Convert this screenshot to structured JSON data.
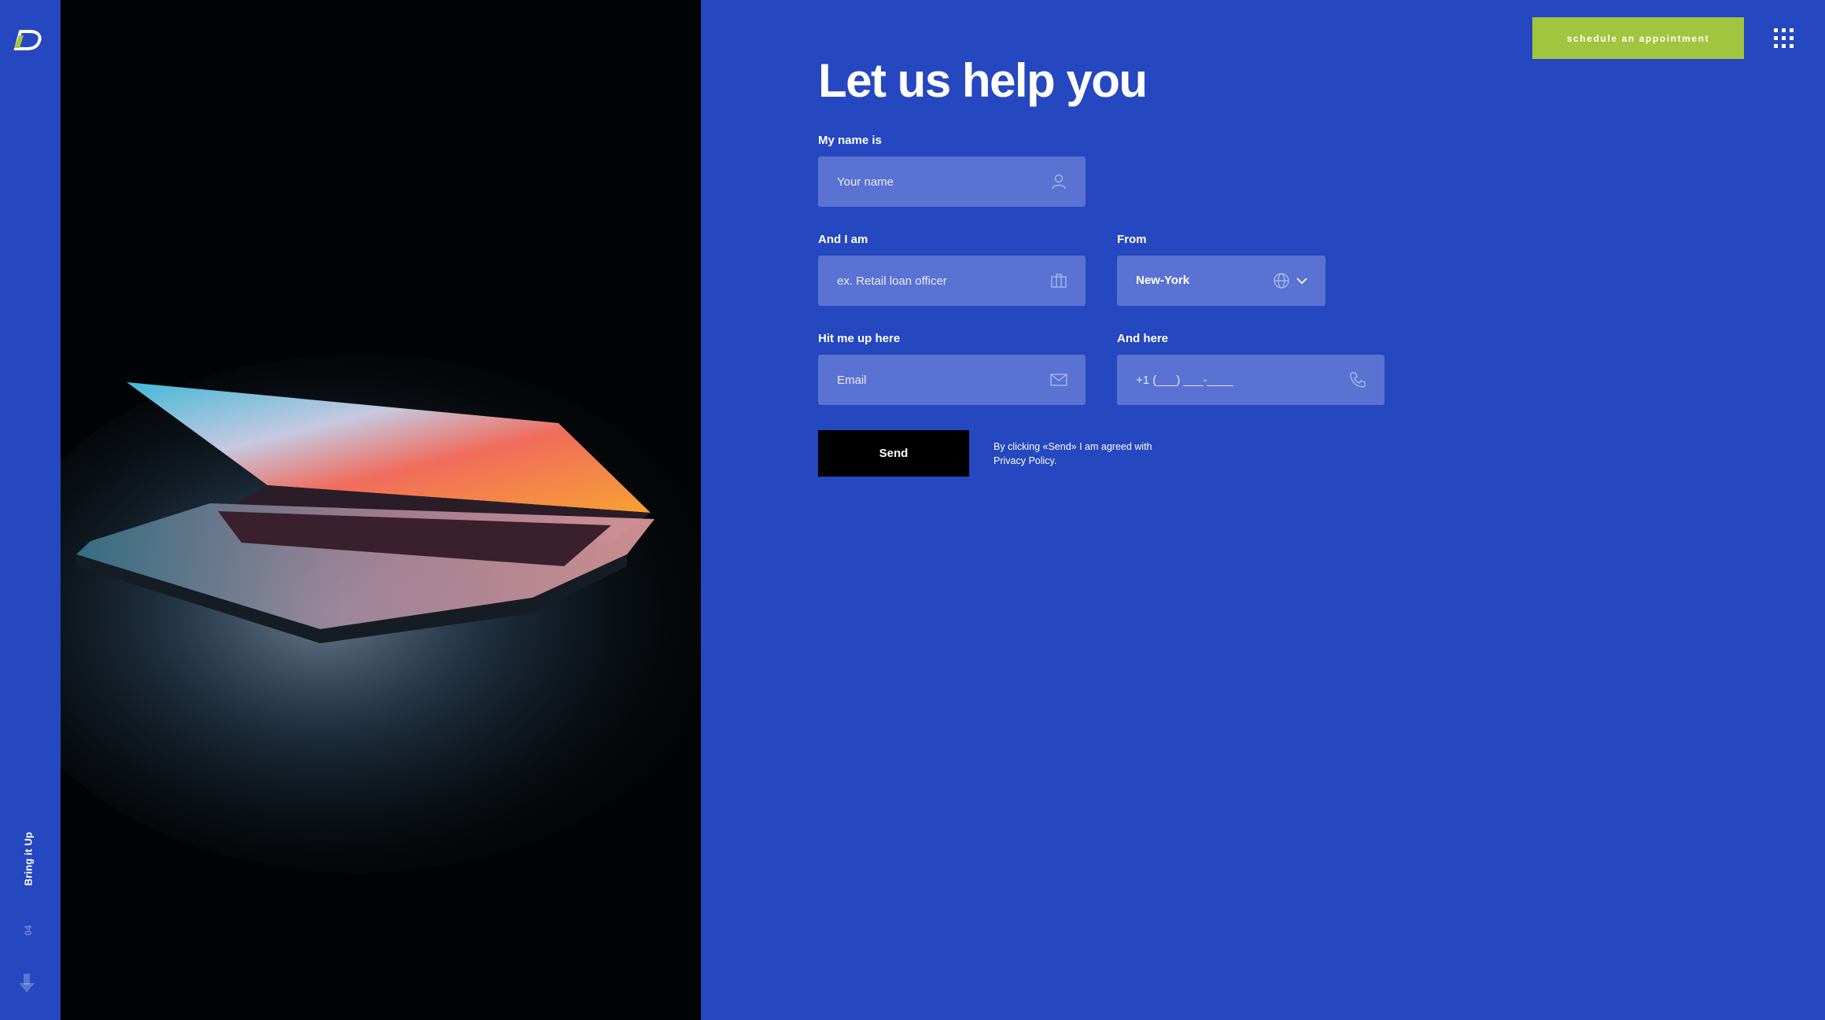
{
  "rail": {
    "logo_icon": "brand-logo-icon",
    "vertical_label": "Bring it Up",
    "page_number": "04",
    "scroll_icon": "arrow-down-icon"
  },
  "header": {
    "cta_label": "schedule an appointment",
    "menu_icon": "grid-menu-icon"
  },
  "form": {
    "title": "Let us help you",
    "name": {
      "label": "My name is",
      "placeholder": "Your name",
      "icon": "user-icon"
    },
    "role": {
      "label": "And I am",
      "placeholder": "ex. Retail loan officer",
      "icon": "briefcase-icon"
    },
    "city": {
      "label": "From",
      "value": "New-York",
      "icon": "globe-icon",
      "arrow_icon": "chevron-down-icon"
    },
    "email": {
      "label": "Hit me up here",
      "placeholder": "Email",
      "icon": "mail-icon"
    },
    "phone": {
      "label": "And here",
      "placeholder": "+1 (___) ___-____",
      "icon": "phone-icon"
    },
    "send_label": "Send",
    "agree_text": "By clicking «Send» I am agreed with",
    "agree_link": "Privacy Policy."
  },
  "colors": {
    "background": "#2547bf",
    "field": "#5a72d1",
    "accent": "#a2c53f",
    "button": "#000000"
  }
}
